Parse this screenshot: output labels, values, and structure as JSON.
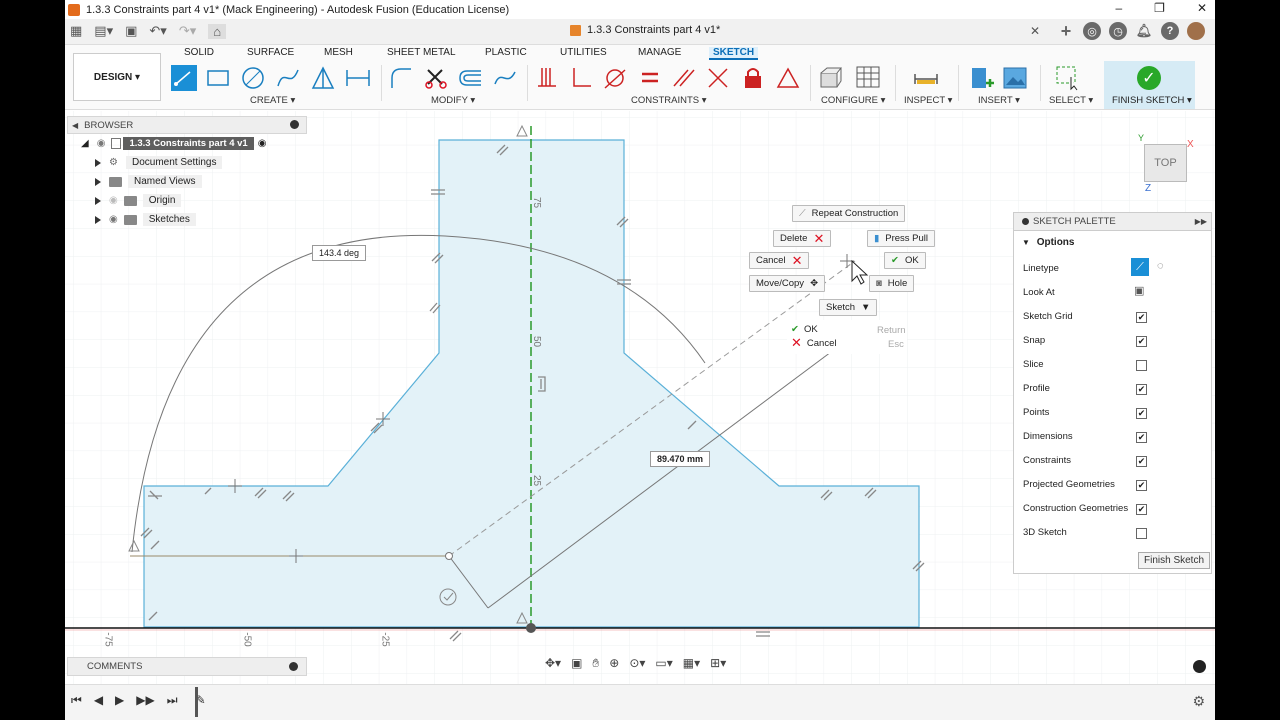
{
  "window": {
    "title": "1.3.3 Constraints part 4 v1* (Mack Engineering) - Autodesk Fusion (Education License)",
    "doc_tab": "1.3.3 Constraints part 4 v1*",
    "controls": [
      "–",
      "❐",
      "✕"
    ]
  },
  "ribbon": {
    "tabs": [
      "SOLID",
      "SURFACE",
      "MESH",
      "SHEET METAL",
      "PLASTIC",
      "UTILITIES",
      "MANAGE",
      "SKETCH"
    ],
    "active_tab": "SKETCH",
    "workspace": "DESIGN ▾",
    "groups": [
      "CREATE ▾",
      "MODIFY ▾",
      "CONSTRAINTS ▾",
      "CONFIGURE ▾",
      "INSPECT ▾",
      "INSERT ▾",
      "SELECT ▾",
      "FINISH SKETCH ▾"
    ]
  },
  "browser": {
    "title": "BROWSER",
    "root": "1.3.3 Constraints part 4 v1",
    "items": [
      "Document Settings",
      "Named Views",
      "Origin",
      "Sketches"
    ]
  },
  "comments": {
    "title": "COMMENTS"
  },
  "marking_menu": {
    "repeat": "Repeat Construction",
    "delete": "Delete",
    "press_pull": "Press Pull",
    "cancel": "Cancel",
    "ok": "OK",
    "move_copy": "Move/Copy",
    "hole": "Hole",
    "sketch": "Sketch",
    "ctx_ok": "OK",
    "ctx_ok_key": "Return",
    "ctx_cancel": "Cancel",
    "ctx_cancel_key": "Esc"
  },
  "dimensions": {
    "angle": "143.4 deg",
    "length": "89.470 mm",
    "axis_labels": [
      "75",
      "50",
      "25"
    ],
    "x_labels": [
      "-75",
      "-50",
      "-25"
    ]
  },
  "palette": {
    "title": "SKETCH PALETTE",
    "options_label": "Options",
    "rows": [
      {
        "label": "Linetype",
        "checked": null
      },
      {
        "label": "Look At",
        "checked": null
      },
      {
        "label": "Sketch Grid",
        "checked": true
      },
      {
        "label": "Snap",
        "checked": true
      },
      {
        "label": "Slice",
        "checked": false
      },
      {
        "label": "Profile",
        "checked": true
      },
      {
        "label": "Points",
        "checked": true
      },
      {
        "label": "Dimensions",
        "checked": true
      },
      {
        "label": "Constraints",
        "checked": true
      },
      {
        "label": "Projected Geometries",
        "checked": true
      },
      {
        "label": "Construction Geometries",
        "checked": true
      },
      {
        "label": "3D Sketch",
        "checked": false
      }
    ],
    "finish_button": "Finish Sketch"
  },
  "viewcube": {
    "face": "TOP",
    "axis_x": "X",
    "axis_y": "Y",
    "axis_z": "Z"
  },
  "colors": {
    "accent": "#0b6fb8",
    "profile_fill": "#e3f2f8",
    "profile_stroke": "#5ab0d8",
    "axis_green": "#2a9a2a"
  }
}
